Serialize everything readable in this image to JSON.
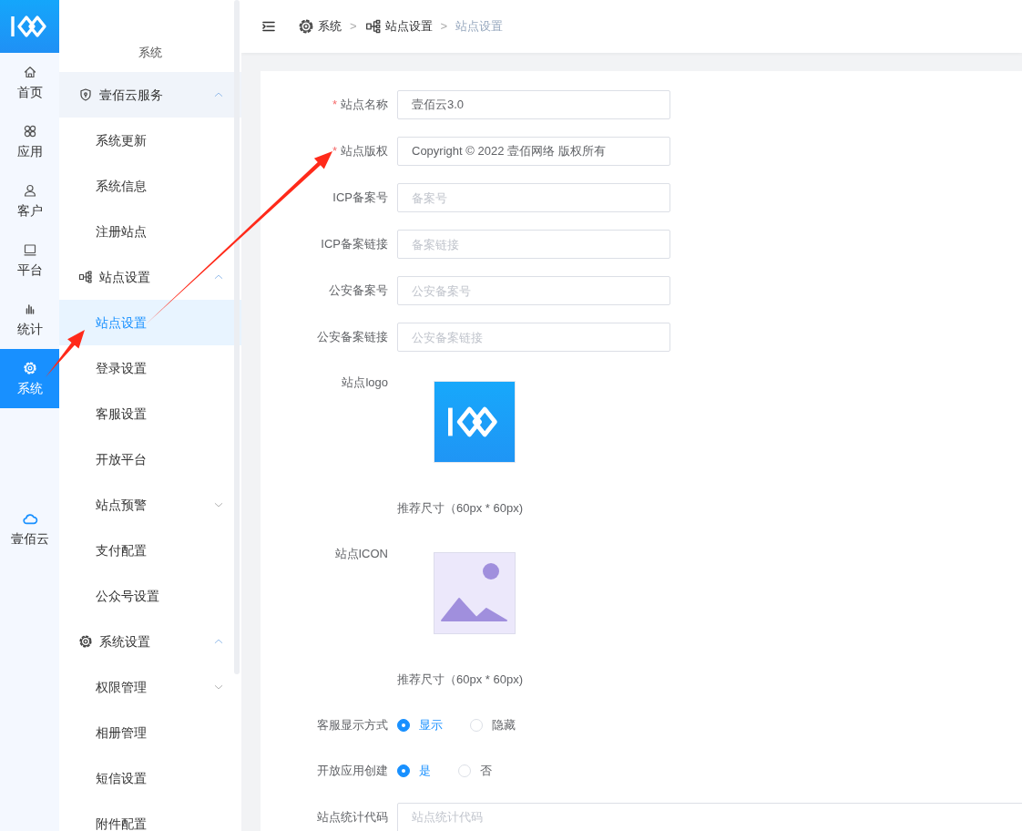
{
  "rail": {
    "items": [
      {
        "label": "首页",
        "selected": false
      },
      {
        "label": "应用",
        "selected": false
      },
      {
        "label": "客户",
        "selected": false
      },
      {
        "label": "平台",
        "selected": false
      },
      {
        "label": "统计",
        "selected": false
      },
      {
        "label": "系统",
        "selected": true
      }
    ],
    "bottom": {
      "label": "壹佰云"
    }
  },
  "menu": {
    "title": "系统",
    "groups": [
      {
        "label": "壹佰云服务",
        "expanded": true,
        "hovered": true,
        "children": [
          {
            "label": "系统更新",
            "selected": false
          },
          {
            "label": "系统信息",
            "selected": false
          },
          {
            "label": "注册站点",
            "selected": false
          }
        ]
      },
      {
        "label": "站点设置",
        "expanded": true,
        "hovered": false,
        "children": [
          {
            "label": "站点设置",
            "selected": true
          },
          {
            "label": "登录设置",
            "selected": false
          },
          {
            "label": "客服设置",
            "selected": false
          },
          {
            "label": "开放平台",
            "selected": false
          },
          {
            "label": "站点预警",
            "selected": false,
            "expanded": false
          },
          {
            "label": "支付配置",
            "selected": false
          },
          {
            "label": "公众号设置",
            "selected": false
          }
        ]
      },
      {
        "label": "系统设置",
        "expanded": true,
        "hovered": false,
        "children": [
          {
            "label": "权限管理",
            "selected": false,
            "expanded": false
          },
          {
            "label": "相册管理",
            "selected": false
          },
          {
            "label": "短信设置",
            "selected": false
          },
          {
            "label": "附件配置",
            "selected": false
          }
        ]
      }
    ]
  },
  "breadcrumb": [
    {
      "label": "系统"
    },
    {
      "separator": ">",
      "label": "站点设置"
    },
    {
      "separator": ">",
      "label": "站点设置"
    }
  ],
  "form": {
    "fields": [
      {
        "kind": "input",
        "label": "站点名称",
        "required_mark": "*",
        "value": "壹佰云3.0"
      },
      {
        "kind": "input",
        "label": "站点版权",
        "required_mark": "*",
        "value": "Copyright © 2022 壹佰网络 版权所有"
      },
      {
        "kind": "input",
        "label": "ICP备案号",
        "placeholder": "备案号"
      },
      {
        "kind": "input",
        "label": "ICP备案链接",
        "placeholder": "备案链接"
      },
      {
        "kind": "input",
        "label": "公安备案号",
        "placeholder": "公安备案号"
      },
      {
        "kind": "input",
        "label": "公安备案链接",
        "placeholder": "公安备案链接"
      },
      {
        "kind": "logo_image",
        "label": "站点logo",
        "hint": "推荐尺寸（60px * 60px)"
      },
      {
        "kind": "placeholder_image",
        "label": "站点ICON",
        "hint": "推荐尺寸（60px * 60px)"
      },
      {
        "kind": "radio",
        "label": "客服显示方式",
        "options": [
          {
            "label": "显示",
            "selected": true
          },
          {
            "label": "隐藏",
            "selected": false
          }
        ]
      },
      {
        "kind": "radio",
        "label": "开放应用创建",
        "options": [
          {
            "label": "是",
            "selected": true
          },
          {
            "label": "否",
            "selected": false
          }
        ]
      },
      {
        "kind": "textarea",
        "label": "站点统计代码",
        "placeholder": "站点统计代码"
      }
    ]
  }
}
